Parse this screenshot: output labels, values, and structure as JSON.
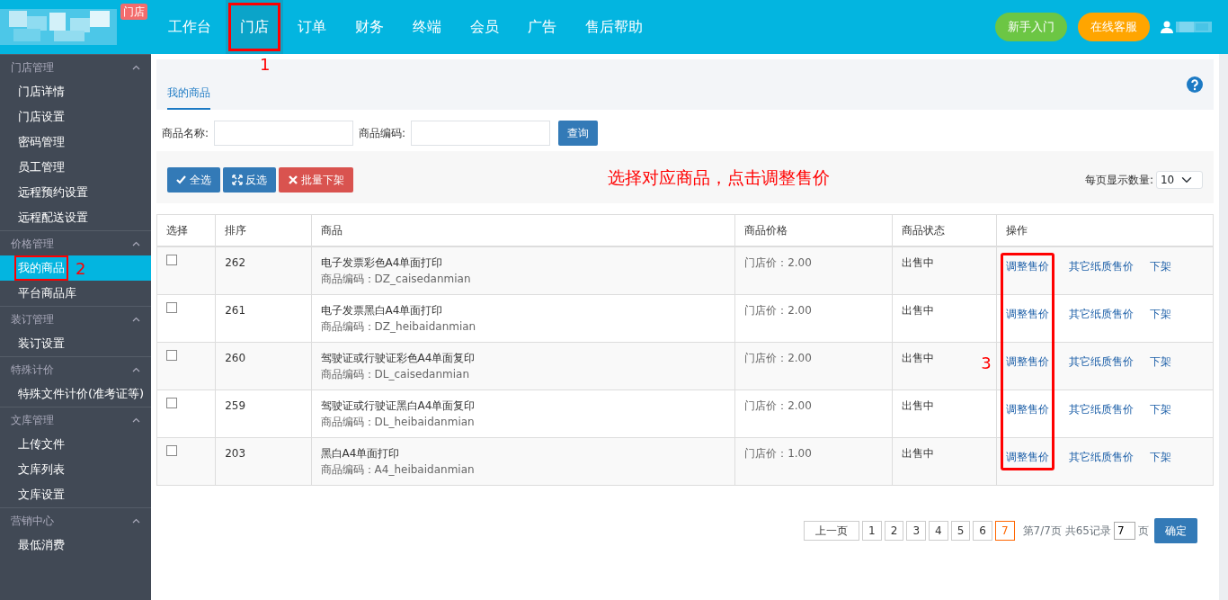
{
  "topbar": {
    "logo_badge": "门店",
    "nav": [
      {
        "label": "工作台",
        "selected": false
      },
      {
        "label": "门店",
        "selected": true,
        "callout": "1"
      },
      {
        "label": "订单",
        "selected": false
      },
      {
        "label": "财务",
        "selected": false
      },
      {
        "label": "终端",
        "selected": false
      },
      {
        "label": "会员",
        "selected": false
      },
      {
        "label": "广告",
        "selected": false
      },
      {
        "label": "售后帮助",
        "selected": false
      }
    ],
    "buttons": [
      {
        "label": "新手入门",
        "color": "#6cc644"
      },
      {
        "label": "在线客服",
        "color": "#ffa500"
      }
    ]
  },
  "sidebar": [
    {
      "title": "门店管理",
      "items": [
        {
          "label": "门店详情",
          "selected": false
        },
        {
          "label": "门店设置",
          "selected": false
        },
        {
          "label": "密码管理",
          "selected": false
        },
        {
          "label": "员工管理",
          "selected": false
        },
        {
          "label": "远程预约设置",
          "selected": false
        },
        {
          "label": "远程配送设置",
          "selected": false
        }
      ]
    },
    {
      "title": "价格管理",
      "items": [
        {
          "label": "我的商品",
          "selected": true,
          "callout": "2"
        },
        {
          "label": "平台商品库",
          "selected": false
        }
      ]
    },
    {
      "title": "装订管理",
      "items": [
        {
          "label": "装订设置",
          "selected": false
        }
      ]
    },
    {
      "title": "特殊计价",
      "items": [
        {
          "label": "特殊文件计价(准考证等)",
          "selected": false
        }
      ]
    },
    {
      "title": "文库管理",
      "items": [
        {
          "label": "上传文件",
          "selected": false
        },
        {
          "label": "文库列表",
          "selected": false
        },
        {
          "label": "文库设置",
          "selected": false
        }
      ]
    },
    {
      "title": "营销中心",
      "items": [
        {
          "label": "最低消费",
          "selected": false
        }
      ]
    }
  ],
  "tabs": [
    {
      "label": "我的商品",
      "selected": true
    }
  ],
  "search": [
    {
      "label": "商品名称:"
    },
    {
      "label": "商品编码:"
    }
  ],
  "search_button": "查询",
  "toolbar": {
    "buttons": [
      {
        "label": "全选",
        "kind": "check"
      },
      {
        "label": "反选",
        "kind": "invert"
      },
      {
        "label": "批量下架",
        "kind": "remove"
      }
    ],
    "instruction": "选择对应商品，点击调整售价",
    "page_size_label": "每页显示数量:",
    "page_size": "10"
  },
  "table": {
    "columns": [
      "选择",
      "排序",
      "商品",
      "商品价格",
      "商品状态",
      "操作"
    ],
    "action_callout": "3",
    "rows": [
      {
        "checked": false,
        "order": "262",
        "name": "电子发票彩色A4单面打印",
        "code": "商品编码：DZ_caisedanmian",
        "price": "门店价：2.00",
        "status": "出售中",
        "actions": [
          "调整售价",
          "其它纸质售价",
          "下架"
        ]
      },
      {
        "checked": false,
        "order": "261",
        "name": "电子发票黑白A4单面打印",
        "code": "商品编码：DZ_heibaidanmian",
        "price": "门店价：2.00",
        "status": "出售中",
        "actions": [
          "调整售价",
          "其它纸质售价",
          "下架"
        ]
      },
      {
        "checked": false,
        "order": "260",
        "name": "驾驶证或行驶证彩色A4单面复印",
        "code": "商品编码：DL_caisedanmian",
        "price": "门店价：2.00",
        "status": "出售中",
        "actions": [
          "调整售价",
          "其它纸质售价",
          "下架"
        ]
      },
      {
        "checked": false,
        "order": "259",
        "name": "驾驶证或行驶证黑白A4单面复印",
        "code": "商品编码：DL_heibaidanmian",
        "price": "门店价：2.00",
        "status": "出售中",
        "actions": [
          "调整售价",
          "其它纸质售价",
          "下架"
        ]
      },
      {
        "checked": false,
        "order": "203",
        "name": "黑白A4单面打印",
        "code": "商品编码：A4_heibaidanmian",
        "price": "门店价：1.00",
        "status": "出售中",
        "actions": [
          "调整售价",
          "其它纸质售价",
          "下架"
        ]
      }
    ]
  },
  "pagination": {
    "prev": "上一页",
    "pages": [
      {
        "label": "1",
        "selected": false
      },
      {
        "label": "2",
        "selected": false
      },
      {
        "label": "3",
        "selected": false
      },
      {
        "label": "4",
        "selected": false
      },
      {
        "label": "5",
        "selected": false
      },
      {
        "label": "6",
        "selected": false
      },
      {
        "label": "7",
        "selected": true
      }
    ],
    "info": "第7/7页 共65记录",
    "page_input": "7",
    "page_unit": "页",
    "go": "确定"
  }
}
